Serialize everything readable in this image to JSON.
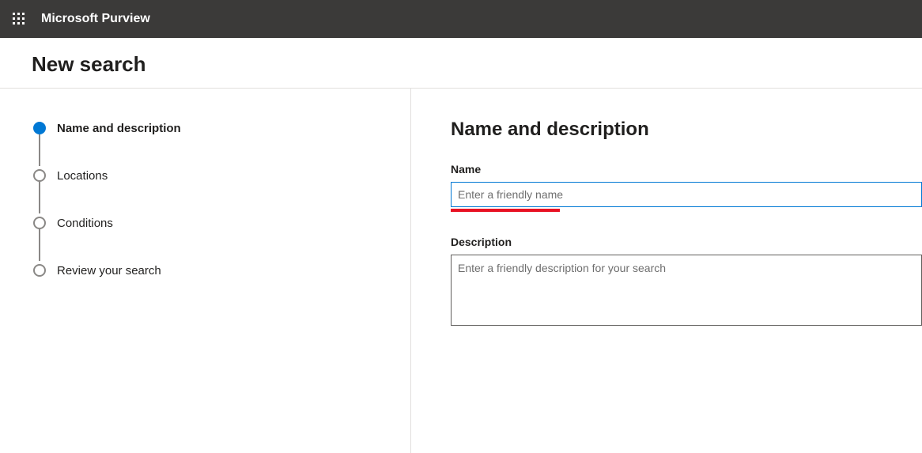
{
  "header": {
    "app_name": "Microsoft Purview"
  },
  "page": {
    "title": "New search"
  },
  "wizard": {
    "steps": [
      {
        "label": "Name and description"
      },
      {
        "label": "Locations"
      },
      {
        "label": "Conditions"
      },
      {
        "label": "Review your search"
      }
    ]
  },
  "form": {
    "section_title": "Name and description",
    "name_label": "Name",
    "name_placeholder": "Enter a friendly name",
    "name_value": "",
    "description_label": "Description",
    "description_placeholder": "Enter a friendly description for your search",
    "description_value": ""
  }
}
